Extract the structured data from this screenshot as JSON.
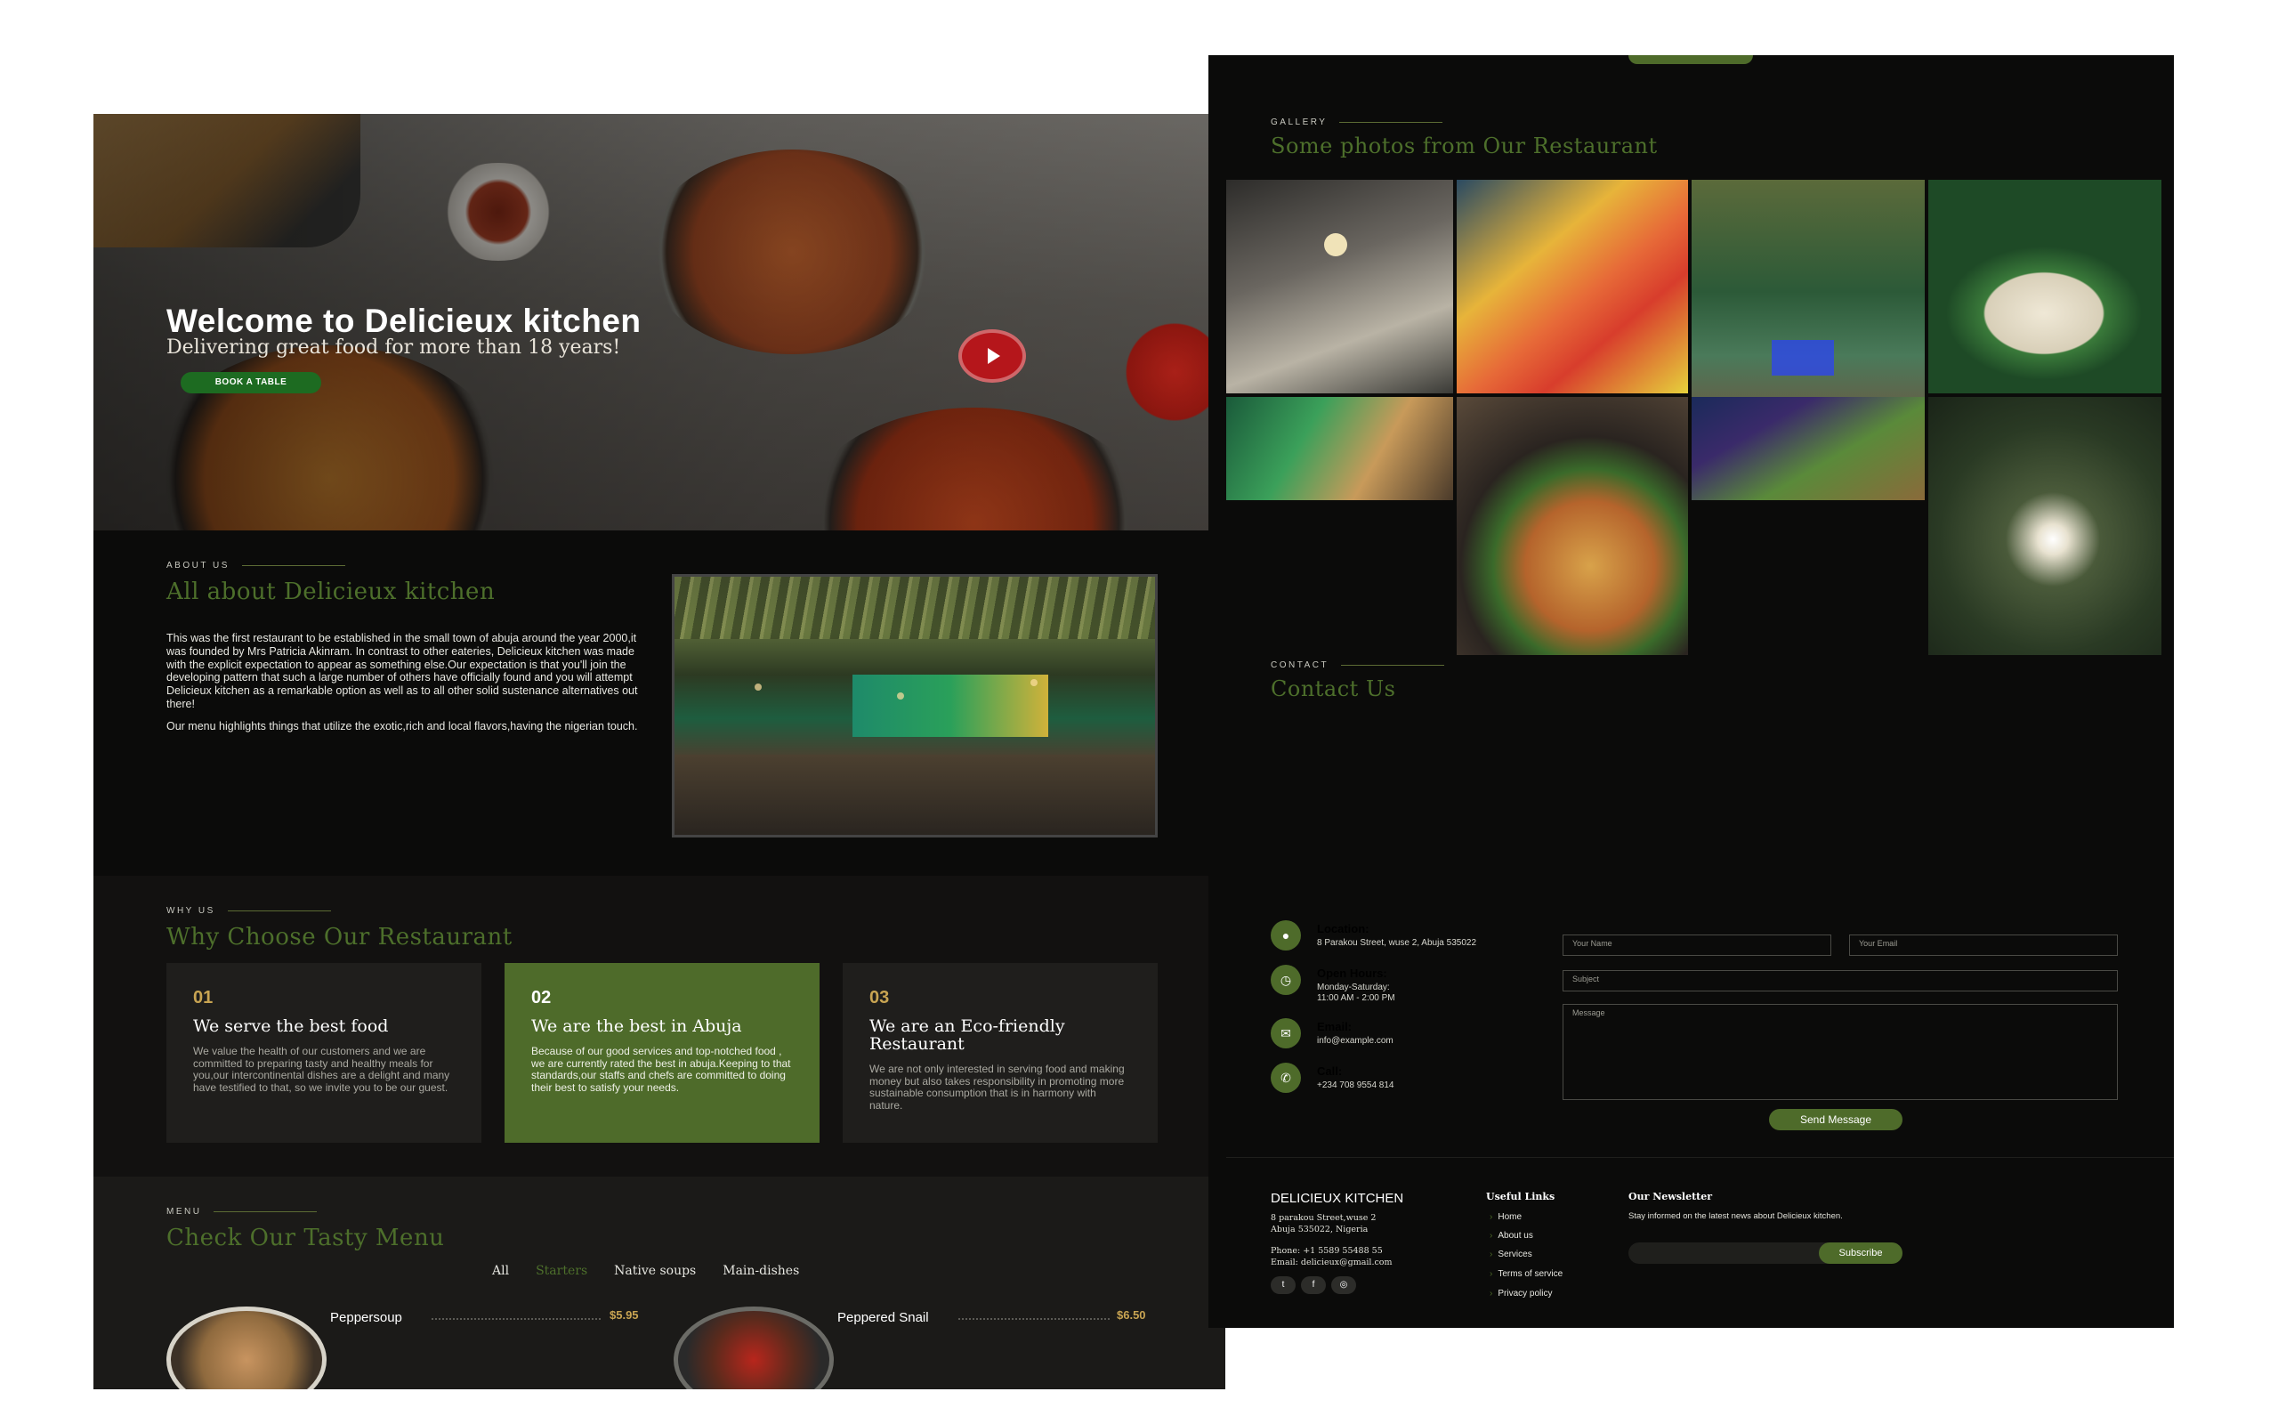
{
  "hero": {
    "title": "Welcome to Delicieux kitchen",
    "subtitle": "Delivering great food for more than 18 years!",
    "book_button": "BOOK A TABLE"
  },
  "about": {
    "eyebrow": "ABOUT US",
    "title": "All about Delicieux kitchen",
    "paragraphs": [
      "This was the first restaurant to be established in the small town of abuja around the year 2000,it was founded by Mrs Patricia Akinram. In contrast to other eateries, Delicieux kitchen was made with the explicit expectation to appear as something else.Our expectation is that you'll join the developing pattern that such a large number of others have officially found and you will attempt Delicieux kitchen as a remarkable option as well as to all other solid sustenance alternatives out there!",
      "Our menu highlights things that utilize the exotic,rich and local flavors,having the nigerian touch."
    ]
  },
  "why": {
    "eyebrow": "WHY US",
    "title": "Why Choose Our Restaurant",
    "cards": [
      {
        "num": "01",
        "title": "We serve the best food",
        "desc": "We value the health of our customers and we are committed to preparing tasty and healthy meals for you,our intercontinental dishes are a delight and many have testified to that, so we invite you to be our guest."
      },
      {
        "num": "02",
        "title": "We are the best in Abuja",
        "desc": "Because of our good services and top-notched food , we are currently rated the best in abuja.Keeping to that standards,our staffs and chefs are committed to doing their best to satisfy your needs."
      },
      {
        "num": "03",
        "title": "We are an Eco-friendly Restaurant",
        "desc": "We are not only interested in serving food and making money but also takes responsibility in promoting more sustainable consumption that is in harmony with nature."
      }
    ]
  },
  "menu": {
    "eyebrow": "MENU",
    "title": "Check Our Tasty Menu",
    "filters": [
      "All",
      "Starters",
      "Native soups",
      "Main-dishes"
    ],
    "active_filter": "Starters",
    "items": [
      {
        "name": "Peppersoup",
        "price": "$5.95"
      },
      {
        "name": "Peppered Snail",
        "price": "$6.50"
      }
    ]
  },
  "gallery": {
    "eyebrow": "GALLERY",
    "title": "Some photos from Our Restaurant"
  },
  "contact": {
    "eyebrow": "CONTACT",
    "title": "Contact Us",
    "location_label": "Location:",
    "location_text": "8 Parakou Street, wuse 2, Abuja 535022",
    "hours_label": "Open Hours:",
    "hours_line1": "Monday-Saturday:",
    "hours_line2": "11:00 AM - 2:00 PM",
    "email_label": "Email:",
    "email_text": "info@example.com",
    "call_label": "Call:",
    "call_text": "+234 708 9554 814",
    "name_placeholder": "Your Name",
    "email_placeholder": "Your Email",
    "subject_placeholder": "Subject",
    "message_placeholder": "Message",
    "send_button": "Send Message"
  },
  "footer": {
    "brand": "DELICIEUX KITCHEN",
    "address_line1": "8 parakou Street,wuse 2",
    "address_line2": "Abuja 535022, Nigeria",
    "phone": "Phone: +1 5589 55488 55",
    "email": "Email: delicieux@gmail.com",
    "links_title": "Useful Links",
    "links": [
      "Home",
      "About us",
      "Services",
      "Terms of service",
      "Privacy policy"
    ],
    "newsletter_title": "Our Newsletter",
    "newsletter_text": "Stay informed on the latest news about Delicieux kitchen.",
    "subscribe_button": "Subscribe",
    "social_icons": [
      "twitter-icon",
      "facebook-icon",
      "instagram-icon"
    ]
  },
  "colors": {
    "accent_green": "#4e6b2a",
    "button_green": "#1d6b21",
    "gold": "#c8a452",
    "play_red": "#b5161b",
    "dark_bg": "#0b0b0a"
  }
}
